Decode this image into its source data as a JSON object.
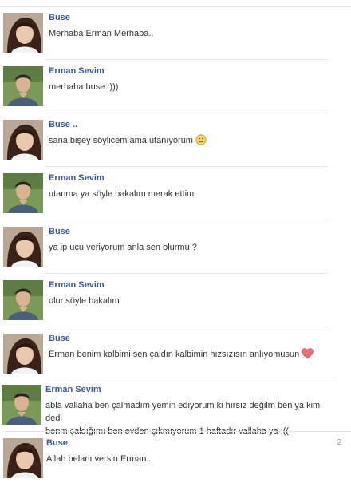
{
  "messages": [
    {
      "name": "Buse",
      "text": "Merhaba Erman Merhaba..",
      "avatar": "girl-avatar"
    },
    {
      "name": "Erman Sevim",
      "text": "merhaba buse :)))",
      "avatar": "boy-avatar"
    },
    {
      "name": "Buse ..",
      "text": "sana bişey söylicem ama utanıyorum",
      "avatar": "girl-avatar",
      "emoji": "sad-face-icon"
    },
    {
      "name": "Erman Sevim",
      "text": "utanma ya söyle bakalım merak ettim",
      "avatar": "boy-avatar"
    },
    {
      "name": "Buse",
      "text": "ya ip ucu veriyorum anla sen olurmu ?",
      "avatar": "girl-avatar"
    },
    {
      "name": "Erman Sevim",
      "text": "olur söyle bakalım",
      "avatar": "boy-avatar"
    },
    {
      "name": "Buse",
      "text": "Erman benim kalbimi sen çaldın kalbimin hızsızısın anlıyomusun",
      "avatar": "girl-avatar",
      "emoji": "heart-icon"
    },
    {
      "name": "Erman Sevim",
      "text": "abla vallaha ben çalmadım yemin ediyorum ki hırsız değilm ben ya kim dedi\nbenm çaldığımı ben evden çıkmıyorum 1 haftadır vallaha ya :((",
      "avatar": "boy-avatar"
    },
    {
      "name": "Buse",
      "text": "Allah belanı versin Erman..",
      "avatar": "girl-avatar",
      "side": "2"
    }
  ],
  "colors": {
    "name": "#3b5998",
    "text": "#333333",
    "separator": "#e3e6ed",
    "heart": "#e0707a"
  }
}
